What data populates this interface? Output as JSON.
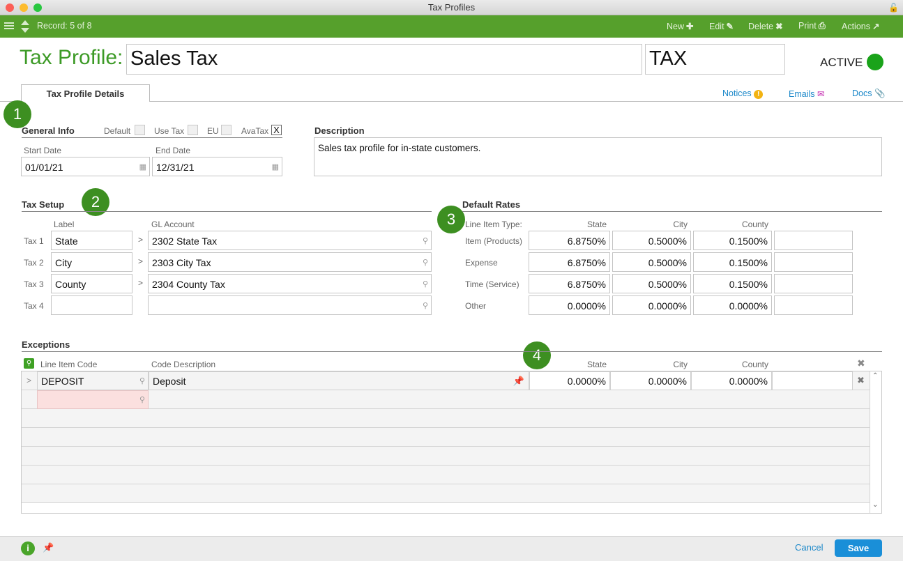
{
  "window": {
    "title": "Tax Profiles"
  },
  "toolbar": {
    "record": "Record: 5 of 8",
    "new": "New",
    "edit": "Edit",
    "delete": "Delete",
    "print": "Print",
    "actions": "Actions"
  },
  "header": {
    "label": "Tax Profile:",
    "name": "Sales Tax",
    "code": "TAX",
    "status": "ACTIVE",
    "status_color": "#1aa31a"
  },
  "tabs": {
    "details": "Tax Profile Details"
  },
  "links": {
    "notices": "Notices",
    "emails": "Emails",
    "docs": "Docs"
  },
  "badges": [
    "1",
    "2",
    "3",
    "4"
  ],
  "general": {
    "title": "General Info",
    "default_label": "Default",
    "usetax_label": "Use Tax",
    "eu_label": "EU",
    "avatax_label": "AvaTax",
    "avatax_mark": "X",
    "start_label": "Start Date",
    "start": "01/01/21",
    "end_label": "End Date",
    "end": "12/31/21"
  },
  "description": {
    "title": "Description",
    "text": "Sales tax profile for in-state customers."
  },
  "tax_setup": {
    "title": "Tax Setup",
    "label_header": "Label",
    "gl_header": "GL Account",
    "rows": [
      {
        "name": "Tax 1",
        "label": "State",
        "gl": "2302 State Tax"
      },
      {
        "name": "Tax 2",
        "label": "City",
        "gl": "2303 City Tax"
      },
      {
        "name": "Tax 3",
        "label": "County",
        "gl": "2304 County Tax"
      },
      {
        "name": "Tax 4",
        "label": "",
        "gl": ""
      }
    ]
  },
  "default_rates": {
    "title": "Default Rates",
    "type_header": "Line Item Type:",
    "state_header": "State",
    "city_header": "City",
    "county_header": "County",
    "rows": [
      {
        "type": "Item (Products)",
        "state": "6.8750%",
        "city": "0.5000%",
        "county": "0.1500%"
      },
      {
        "type": "Expense",
        "state": "6.8750%",
        "city": "0.5000%",
        "county": "0.1500%"
      },
      {
        "type": "Time (Service)",
        "state": "6.8750%",
        "city": "0.5000%",
        "county": "0.1500%"
      },
      {
        "type": "Other",
        "state": "0.0000%",
        "city": "0.0000%",
        "county": "0.0000%"
      }
    ]
  },
  "exceptions": {
    "title": "Exceptions",
    "code_header": "Line Item Code",
    "desc_header": "Code Description",
    "state_header": "State",
    "city_header": "City",
    "county_header": "County",
    "row": {
      "code": "DEPOSIT",
      "desc": "Deposit",
      "state": "0.0000%",
      "city": "0.0000%",
      "county": "0.0000%"
    }
  },
  "footer": {
    "cancel": "Cancel",
    "save": "Save"
  }
}
